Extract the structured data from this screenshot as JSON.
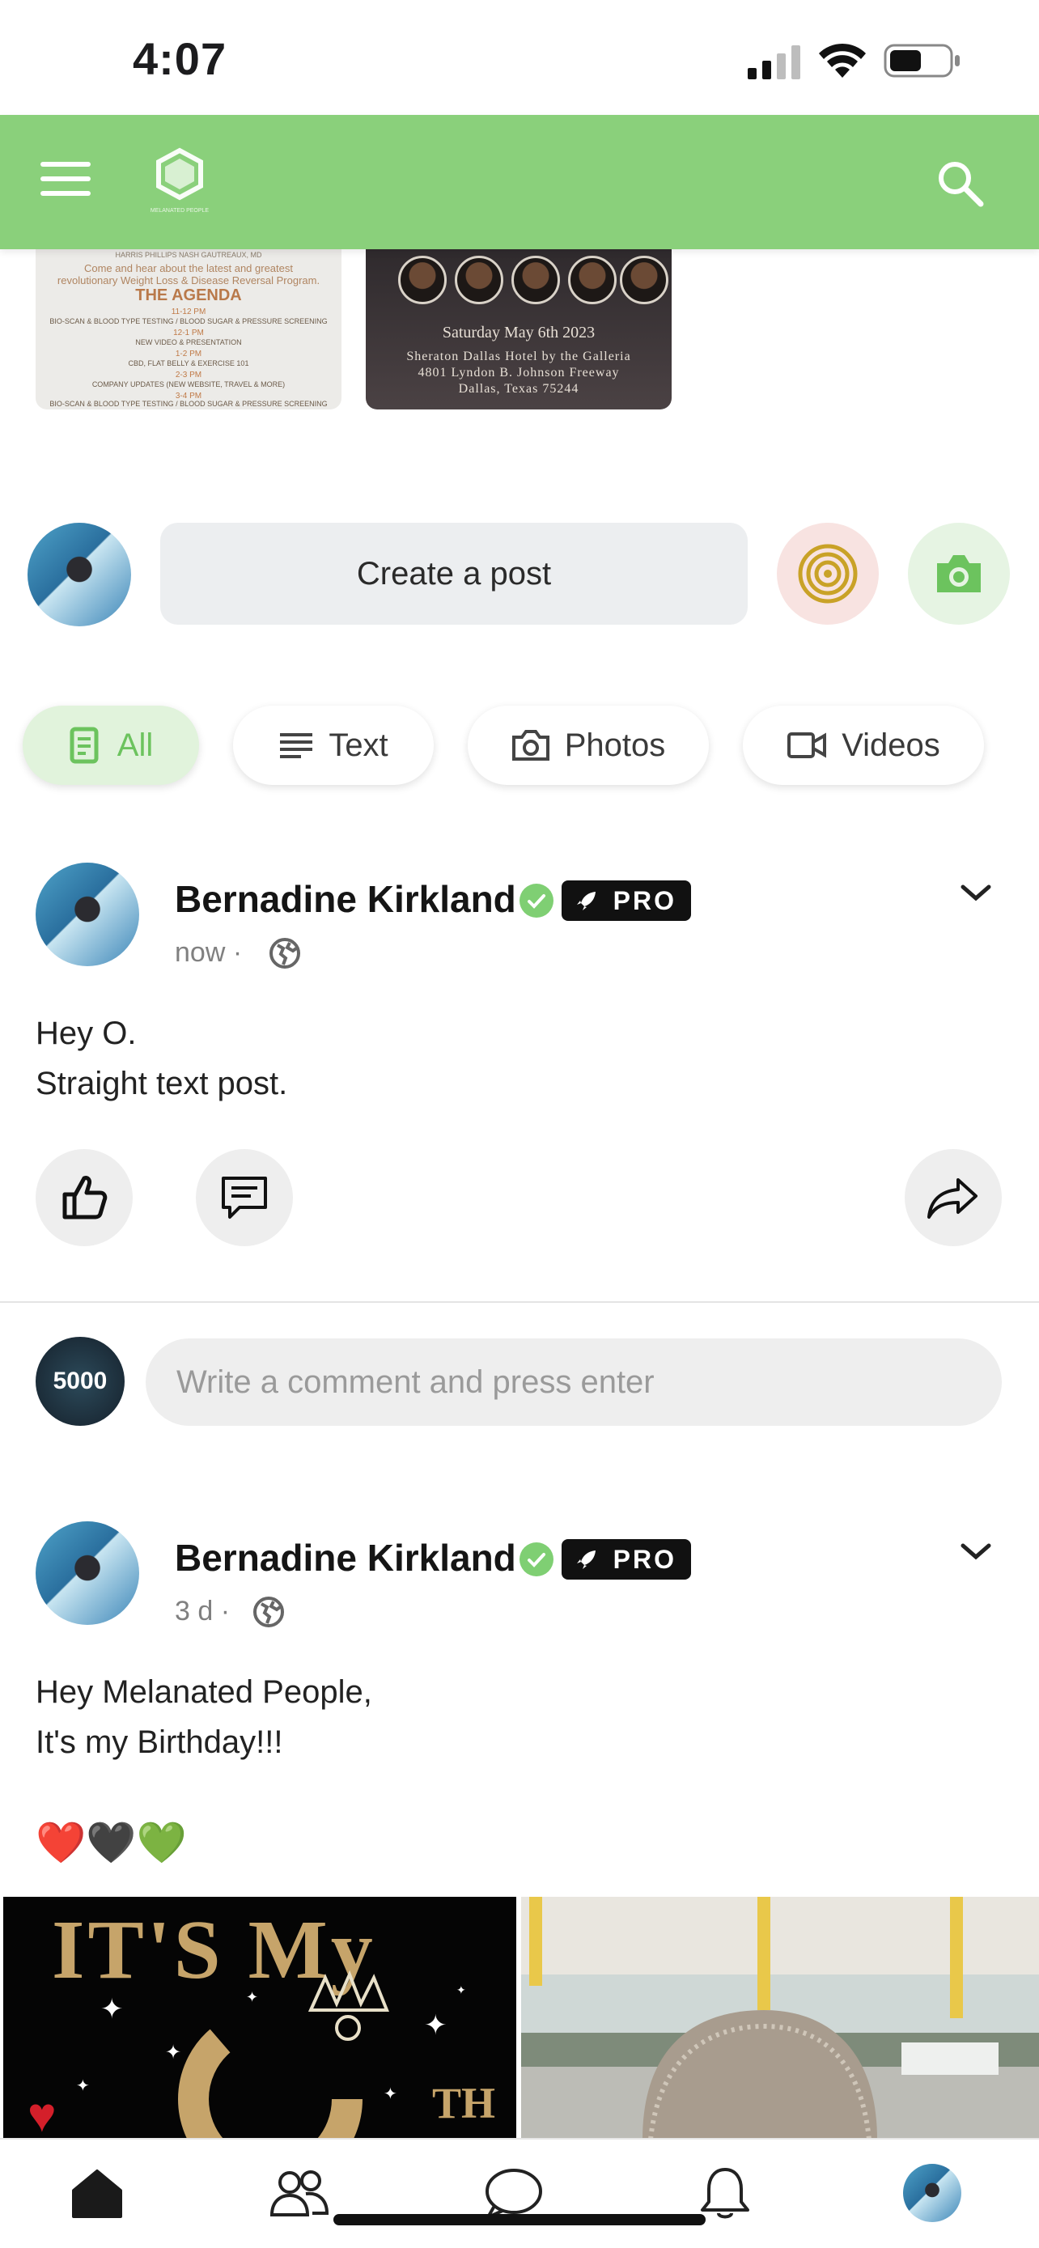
{
  "status_bar": {
    "time": "4:07"
  },
  "header": {
    "logo_text": "MELANATED PEOPLE"
  },
  "thumbnails": {
    "agenda": {
      "names": "HARRIS   PHILLIPS   NASH   GAUTREAUX, MD",
      "tagline_1": "Come and hear about the latest and greatest",
      "tagline_2": "revolutionary Weight Loss & Disease Reversal Program.",
      "title": "THE AGENDA",
      "slot_1_time": "11-12 PM",
      "slot_1": "BIO-SCAN & BLOOD TYPE TESTING / BLOOD SUGAR & PRESSURE SCREENING",
      "slot_2_time": "12-1 PM",
      "slot_2": "NEW VIDEO & PRESENTATION",
      "slot_3_time": "1-2 PM",
      "slot_3": "CBD, FLAT BELLY & EXERCISE 101",
      "slot_4_time": "2-3 PM",
      "slot_4": "COMPANY UPDATES (NEW WEBSITE, TRAVEL & MORE)",
      "slot_5_time": "3-4 PM",
      "slot_5": "BIO-SCAN & BLOOD TYPE TESTING / BLOOD SUGAR & PRESSURE SCREENING"
    },
    "event": {
      "date_line": "Saturday     May 6th     2023",
      "venue_1": "Sheraton Dallas Hotel by the Galleria",
      "venue_2": "4801 Lyndon B. Johnson Freeway",
      "venue_3": "Dallas, Texas 75244"
    }
  },
  "composer": {
    "create_post_label": "Create a post"
  },
  "filters": [
    {
      "label": "All",
      "active": true
    },
    {
      "label": "Text",
      "active": false
    },
    {
      "label": "Photos",
      "active": false
    },
    {
      "label": "Videos",
      "active": false
    }
  ],
  "posts": [
    {
      "author": "Bernadine Kirkland",
      "badge": "PRO",
      "time": "now",
      "separator": "·",
      "text_lines": [
        "Hey O.",
        "Straight text post."
      ]
    },
    {
      "author": "Bernadine Kirkland",
      "badge": "PRO",
      "time": "3 d",
      "separator": "·",
      "text_lines": [
        "Hey Melanated People,",
        "It's my Birthday!!!",
        "",
        "❤️🖤💚"
      ],
      "photo_left_text": "IT'S My",
      "photo_left_suffix": "TH"
    }
  ],
  "comment": {
    "avatar_label": "5000",
    "placeholder": "Write a comment and press enter"
  },
  "colors": {
    "brand_green": "#8ad07b",
    "verified_green": "#7fcf73",
    "active_tab_bg": "#e1f3dc"
  },
  "icons": {
    "header": [
      "menu-icon",
      "logo-icon",
      "search-icon"
    ],
    "actions": [
      "thumbs-up-icon",
      "comment-icon",
      "share-icon"
    ],
    "nav": [
      "home-icon",
      "people-icon",
      "chat-icon",
      "bell-icon",
      "profile-avatar"
    ]
  }
}
